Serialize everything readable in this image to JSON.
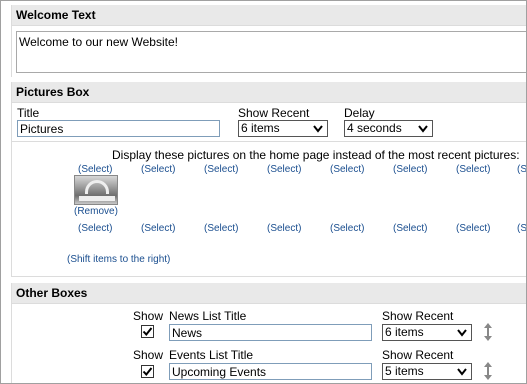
{
  "welcome": {
    "header": "Welcome Text",
    "text": "Welcome to our new Website!"
  },
  "pictures": {
    "header": "Pictures Box",
    "title_label": "Title",
    "title_value": "Pictures",
    "show_recent_label": "Show Recent",
    "show_recent_value": "6 items",
    "delay_label": "Delay",
    "delay_value": "4 seconds",
    "display_text": "Display these pictures on the home page instead of the most recent pictures:",
    "select_label": "(Select)",
    "remove_label": "(Remove)",
    "shift_label": "(Shift items to the right)"
  },
  "other": {
    "header": "Other Boxes",
    "rows": [
      {
        "show_label": "Show",
        "checked": true,
        "title_label": "News List Title",
        "title_value": "News",
        "recent_label": "Show Recent",
        "recent_value": "6 items",
        "icon": "up-down-arrow-icon"
      },
      {
        "show_label": "Show",
        "checked": true,
        "title_label": "Events List Title",
        "title_value": "Upcoming Events",
        "recent_label": "Show Recent",
        "recent_value": "5 items",
        "icon": "up-down-arrow-icon"
      }
    ]
  }
}
